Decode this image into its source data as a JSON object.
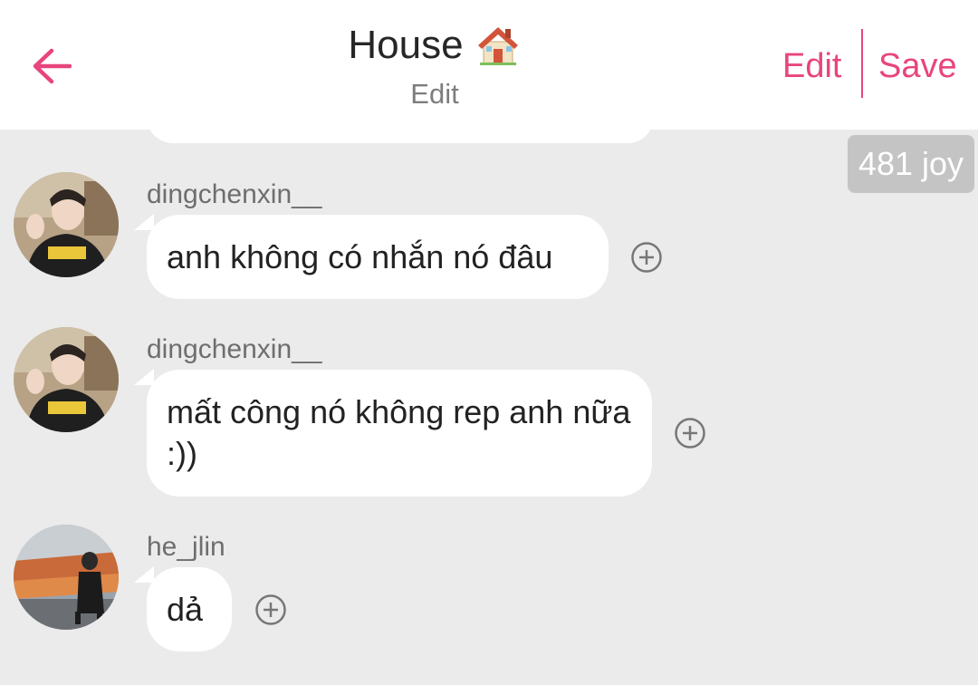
{
  "header": {
    "title": "House",
    "subtitle": "Edit",
    "edit_label": "Edit",
    "save_label": "Save",
    "accent_color": "#e8457e",
    "back_icon": "arrow-left-icon",
    "title_icon": "house-icon"
  },
  "joy_badge": "481 joy",
  "messages": [
    {
      "username": "dingchenxin__",
      "text": "anh không có nhắn nó đâu",
      "avatar": "avatar-photo",
      "action_icon": "add-circle-icon"
    },
    {
      "username": "dingchenxin__",
      "text": "mất công nó không rep anh nữa :))",
      "avatar": "avatar-photo",
      "action_icon": "add-circle-icon"
    },
    {
      "username": "he_jlin",
      "text": "dả",
      "avatar": "avatar-photo",
      "action_icon": "add-circle-icon"
    }
  ]
}
